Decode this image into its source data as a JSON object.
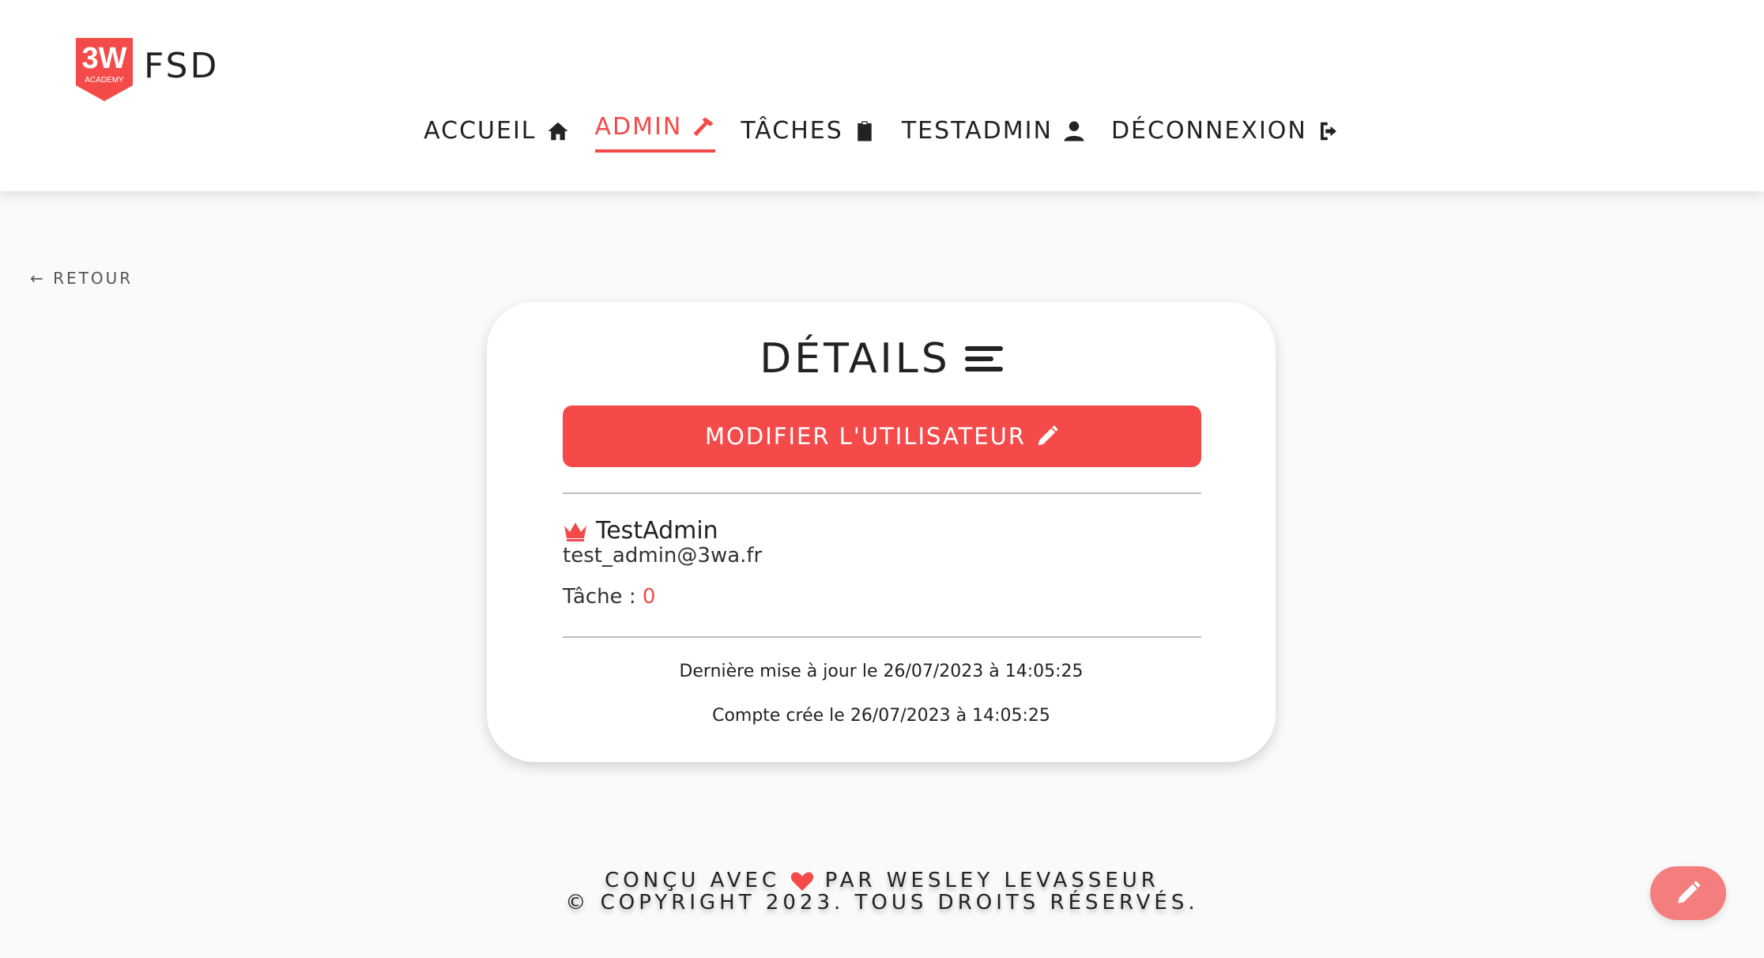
{
  "header": {
    "logo_text": "3W",
    "logo_subtext": "ACADEMY",
    "brand": "FSD",
    "nav": [
      {
        "label": "ACCUEIL",
        "icon": "home-icon",
        "active": false
      },
      {
        "label": "ADMIN",
        "icon": "hammer-icon",
        "active": true
      },
      {
        "label": "TÂCHES",
        "icon": "clipboard-icon",
        "active": false
      },
      {
        "label": "TESTADMIN",
        "icon": "user-icon",
        "active": false
      },
      {
        "label": "DÉCONNEXION",
        "icon": "logout-icon",
        "active": false
      }
    ]
  },
  "back_label": "← RETOUR",
  "card": {
    "title": "DÉTAILS",
    "edit_button_label": "MODIFIER L'UTILISATEUR",
    "user": {
      "name": "TestAdmin",
      "email": "test_admin@3wa.fr",
      "task_label": "Tâche :",
      "task_count": "0"
    },
    "last_update": "Dernière mise à jour le 26/07/2023 à 14:05:25",
    "created": "Compte crée le 26/07/2023 à 14:05:25"
  },
  "footer": {
    "line1_before": "CONÇU AVEC",
    "line1_after": "PAR WESLEY LEVASSEUR",
    "line2": "© COPYRIGHT 2023. TOUS DROITS RÉSERVÉS."
  },
  "colors": {
    "accent": "#f44a4a",
    "fab": "#f47d7d"
  }
}
